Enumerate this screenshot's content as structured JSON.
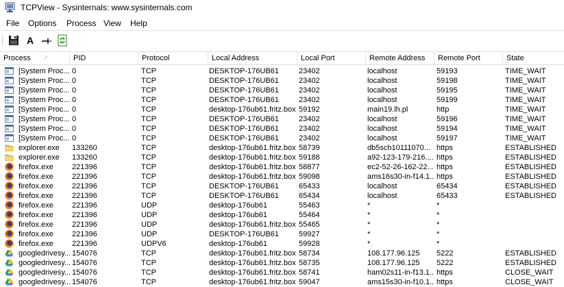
{
  "window": {
    "title": "TCPView - Sysinternals: www.sysinternals.com"
  },
  "menu": {
    "items": [
      "File",
      "Options",
      "Process",
      "View",
      "Help"
    ]
  },
  "toolbar": {
    "buttons": [
      {
        "name": "save-button",
        "icon": "floppy-disk-icon"
      },
      {
        "name": "font-button",
        "icon": "letter-a-icon",
        "glyph": "A"
      },
      {
        "name": "resolve-addresses-button",
        "icon": "connection-icon"
      },
      {
        "name": "refresh-button",
        "icon": "green-refresh-icon"
      }
    ]
  },
  "columns": [
    "Process",
    "PID",
    "Protocol",
    "Local Address",
    "Local Port",
    "Remote Address",
    "Remote Port",
    "State"
  ],
  "sort": {
    "column": "Process",
    "direction": "ascending"
  },
  "rows": [
    {
      "icon": "system-window-icon",
      "process": "[System Proc...",
      "pid": "0",
      "protocol": "TCP",
      "local_address": "DESKTOP-176UB61",
      "local_port": "23402",
      "remote_address": "localhost",
      "remote_port": "59193",
      "state": "TIME_WAIT"
    },
    {
      "icon": "system-window-icon",
      "process": "[System Proc...",
      "pid": "0",
      "protocol": "TCP",
      "local_address": "DESKTOP-176UB61",
      "local_port": "23402",
      "remote_address": "localhost",
      "remote_port": "59198",
      "state": "TIME_WAIT"
    },
    {
      "icon": "system-window-icon",
      "process": "[System Proc...",
      "pid": "0",
      "protocol": "TCP",
      "local_address": "DESKTOP-176UB61",
      "local_port": "23402",
      "remote_address": "localhost",
      "remote_port": "59195",
      "state": "TIME_WAIT"
    },
    {
      "icon": "system-window-icon",
      "process": "[System Proc...",
      "pid": "0",
      "protocol": "TCP",
      "local_address": "DESKTOP-176UB61",
      "local_port": "23402",
      "remote_address": "localhost",
      "remote_port": "59199",
      "state": "TIME_WAIT"
    },
    {
      "icon": "system-window-icon",
      "process": "[System Proc...",
      "pid": "0",
      "protocol": "TCP",
      "local_address": "desktop-176ub61.fritz.box",
      "local_port": "59192",
      "remote_address": "main19.lh.pl",
      "remote_port": "http",
      "state": "TIME_WAIT"
    },
    {
      "icon": "system-window-icon",
      "process": "[System Proc...",
      "pid": "0",
      "protocol": "TCP",
      "local_address": "DESKTOP-176UB61",
      "local_port": "23402",
      "remote_address": "localhost",
      "remote_port": "59196",
      "state": "TIME_WAIT"
    },
    {
      "icon": "system-window-icon",
      "process": "[System Proc...",
      "pid": "0",
      "protocol": "TCP",
      "local_address": "DESKTOP-176UB61",
      "local_port": "23402",
      "remote_address": "localhost",
      "remote_port": "59194",
      "state": "TIME_WAIT"
    },
    {
      "icon": "system-window-icon",
      "process": "[System Proc...",
      "pid": "0",
      "protocol": "TCP",
      "local_address": "DESKTOP-176UB61",
      "local_port": "23402",
      "remote_address": "localhost",
      "remote_port": "59197",
      "state": "TIME_WAIT"
    },
    {
      "icon": "folder-icon",
      "process": "explorer.exe",
      "pid": "133260",
      "protocol": "TCP",
      "local_address": "desktop-176ub61.fritz.box",
      "local_port": "58739",
      "remote_address": "db5sch10111070...",
      "remote_port": "https",
      "state": "ESTABLISHED"
    },
    {
      "icon": "folder-icon",
      "process": "explorer.exe",
      "pid": "133260",
      "protocol": "TCP",
      "local_address": "desktop-176ub61.fritz.box",
      "local_port": "59188",
      "remote_address": "a92-123-179-216....",
      "remote_port": "https",
      "state": "ESTABLISHED"
    },
    {
      "icon": "firefox-icon",
      "process": "firefox.exe",
      "pid": "221396",
      "protocol": "TCP",
      "local_address": "desktop-176ub61.fritz.box",
      "local_port": "58877",
      "remote_address": "ec2-52-26-162-22...",
      "remote_port": "https",
      "state": "ESTABLISHED"
    },
    {
      "icon": "firefox-icon",
      "process": "firefox.exe",
      "pid": "221396",
      "protocol": "TCP",
      "local_address": "desktop-176ub61.fritz.box",
      "local_port": "59098",
      "remote_address": "ams16s30-in-f14.1...",
      "remote_port": "https",
      "state": "ESTABLISHED"
    },
    {
      "icon": "firefox-icon",
      "process": "firefox.exe",
      "pid": "221396",
      "protocol": "TCP",
      "local_address": "DESKTOP-176UB61",
      "local_port": "65433",
      "remote_address": "localhost",
      "remote_port": "65434",
      "state": "ESTABLISHED"
    },
    {
      "icon": "firefox-icon",
      "process": "firefox.exe",
      "pid": "221396",
      "protocol": "TCP",
      "local_address": "DESKTOP-176UB61",
      "local_port": "65434",
      "remote_address": "localhost",
      "remote_port": "65433",
      "state": "ESTABLISHED"
    },
    {
      "icon": "firefox-icon",
      "process": "firefox.exe",
      "pid": "221396",
      "protocol": "UDP",
      "local_address": "desktop-176ub61",
      "local_port": "55463",
      "remote_address": "*",
      "remote_port": "*",
      "state": ""
    },
    {
      "icon": "firefox-icon",
      "process": "firefox.exe",
      "pid": "221396",
      "protocol": "UDP",
      "local_address": "desktop-176ub61",
      "local_port": "55464",
      "remote_address": "*",
      "remote_port": "*",
      "state": ""
    },
    {
      "icon": "firefox-icon",
      "process": "firefox.exe",
      "pid": "221396",
      "protocol": "UDP",
      "local_address": "desktop-176ub61.fritz.box",
      "local_port": "55465",
      "remote_address": "*",
      "remote_port": "*",
      "state": ""
    },
    {
      "icon": "firefox-icon",
      "process": "firefox.exe",
      "pid": "221396",
      "protocol": "UDP",
      "local_address": "DESKTOP-176UB61",
      "local_port": "59927",
      "remote_address": "*",
      "remote_port": "*",
      "state": ""
    },
    {
      "icon": "firefox-icon",
      "process": "firefox.exe",
      "pid": "221396",
      "protocol": "UDPV6",
      "local_address": "desktop-176ub61",
      "local_port": "59928",
      "remote_address": "*",
      "remote_port": "*",
      "state": ""
    },
    {
      "icon": "google-drive-icon",
      "process": "googledrivesy...",
      "pid": "154076",
      "protocol": "TCP",
      "local_address": "desktop-176ub61.fritz.box",
      "local_port": "58734",
      "remote_address": "108.177.96.125",
      "remote_port": "5222",
      "state": "ESTABLISHED"
    },
    {
      "icon": "google-drive-icon",
      "process": "googledrivesy...",
      "pid": "154076",
      "protocol": "TCP",
      "local_address": "desktop-176ub61.fritz.box",
      "local_port": "58735",
      "remote_address": "108.177.96.125",
      "remote_port": "5222",
      "state": "ESTABLISHED"
    },
    {
      "icon": "google-drive-icon",
      "process": "googledrivesy...",
      "pid": "154076",
      "protocol": "TCP",
      "local_address": "desktop-176ub61.fritz.box",
      "local_port": "58741",
      "remote_address": "ham02s11-in-f13.1...",
      "remote_port": "https",
      "state": "CLOSE_WAIT"
    },
    {
      "icon": "google-drive-icon",
      "process": "googledrivesy...",
      "pid": "154076",
      "protocol": "TCP",
      "local_address": "desktop-176ub61.fritz.box",
      "local_port": "59047",
      "remote_address": "ams15s30-in-f10.1...",
      "remote_port": "https",
      "state": "CLOSE_WAIT"
    }
  ]
}
